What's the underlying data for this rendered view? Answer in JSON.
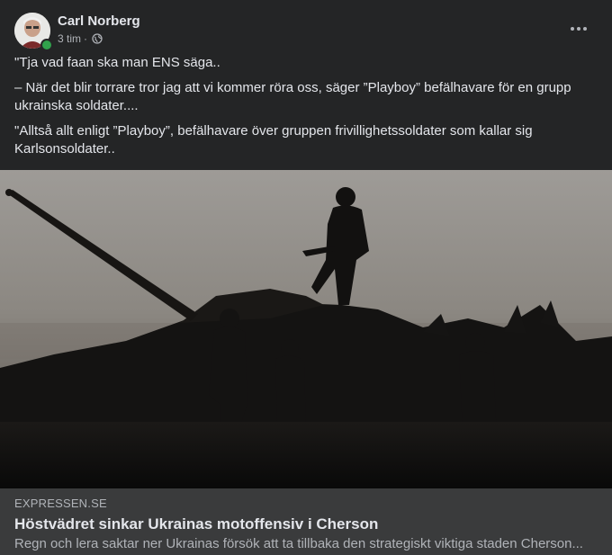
{
  "post": {
    "author": "Carl Norberg",
    "time": "3 tim",
    "time_sep": "·",
    "privacy_icon": "globe-icon",
    "more_icon": "more-options-icon",
    "paragraphs": [
      "\"Tja vad faan ska man ENS säga..",
      "– När det blir torrare tror jag att vi kommer röra oss, säger ”Playboy” befälhavare för en grupp ukrainska soldater....",
      "\"Alltså allt enligt ”Playboy”, befälhavare över gruppen frivillighetssoldater som kallar sig Karlsonsoldater.."
    ]
  },
  "link": {
    "domain": "EXPRESSEN.SE",
    "title": "Höstvädret sinkar Ukrainas motoffensiv i Cherson",
    "description": "Regn och lera saktar ner Ukrainas försök att ta tillbaka den strategiskt viktiga staden Cherson..."
  },
  "colors": {
    "card_bg": "#242526",
    "link_bg": "#3a3b3c",
    "online": "#31a24c"
  }
}
